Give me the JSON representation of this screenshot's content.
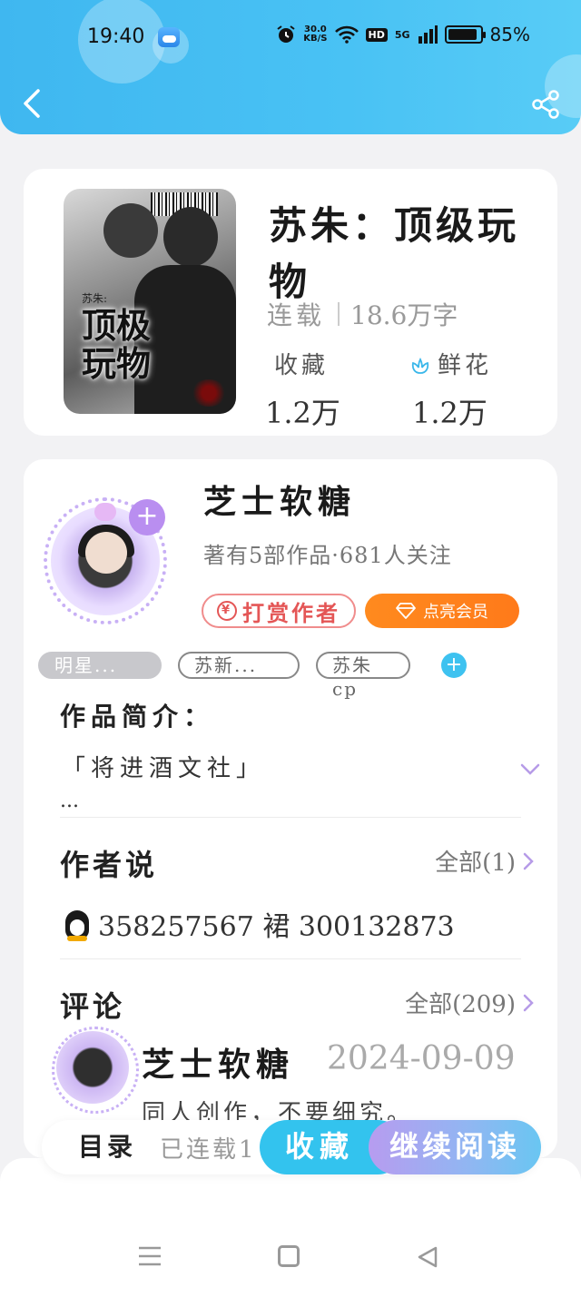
{
  "status_bar": {
    "time": "19:40",
    "net_speed_value": "30.0",
    "net_speed_unit": "KB/S",
    "hd_label": "HD",
    "network_label": "5G",
    "battery": "85%"
  },
  "book": {
    "title": "苏朱：顶级玩物",
    "cover_title": "顶极玩物",
    "cover_subtitle": "苏朱:",
    "status": "连载",
    "word_count": "18.6万字",
    "favorites_label": "收藏",
    "favorites_value": "1.2万",
    "flowers_label": "鲜花",
    "flowers_value": "1.2万"
  },
  "author": {
    "name": "芝士软糖",
    "meta": "著有5部作品·681人关注",
    "reward_label": "打赏作者",
    "reward_icon_char": "¥",
    "vip_label": "点亮会员",
    "tags": [
      "明星...",
      "苏新...",
      "苏朱cp"
    ]
  },
  "intro": {
    "title": "作品简介：",
    "text": "「将进酒文社」",
    "ellipsis": "..."
  },
  "author_says": {
    "title": "作者说",
    "more": "全部(1)",
    "content": "358257567 裙 300132873"
  },
  "comments": {
    "title": "评论",
    "more": "全部(209)",
    "items": [
      {
        "user": "芝士软糖",
        "date": "2024-09-09",
        "text": "同人创作，不要细究。"
      }
    ]
  },
  "bottom_bar": {
    "toc_label": "目录",
    "toc_status": "已连载1",
    "favorite_button": "收藏",
    "read_button": "继续阅读"
  },
  "colors": {
    "header": "#49c2f4",
    "accent_orange": "#ff8a1e",
    "reward_red": "#e45656",
    "purple": "#b98ef0"
  }
}
